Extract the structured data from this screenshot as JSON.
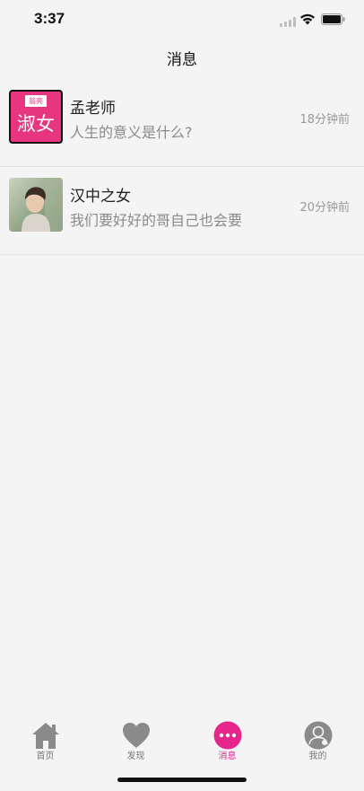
{
  "status_bar": {
    "time": "3:37"
  },
  "nav": {
    "title": "消息"
  },
  "conversations": [
    {
      "name": "孟老师",
      "message": "人生的意义是什么?",
      "time": "18分钟前",
      "avatar_badge": "翁亮",
      "avatar_text": "淑女",
      "avatar_color": "#e8357f"
    },
    {
      "name": "汉中之女",
      "message": "我们要好好的哥自己也会要",
      "time": "20分钟前"
    }
  ],
  "tabs": [
    {
      "label": "首页",
      "icon": "home-icon"
    },
    {
      "label": "发现",
      "icon": "heart-icon"
    },
    {
      "label": "消息",
      "icon": "message-icon",
      "active": true
    },
    {
      "label": "我的",
      "icon": "profile-icon"
    }
  ],
  "colors": {
    "accent": "#e5268d",
    "inactive_icon": "#8a8a8a",
    "background": "#f4f4f4"
  }
}
